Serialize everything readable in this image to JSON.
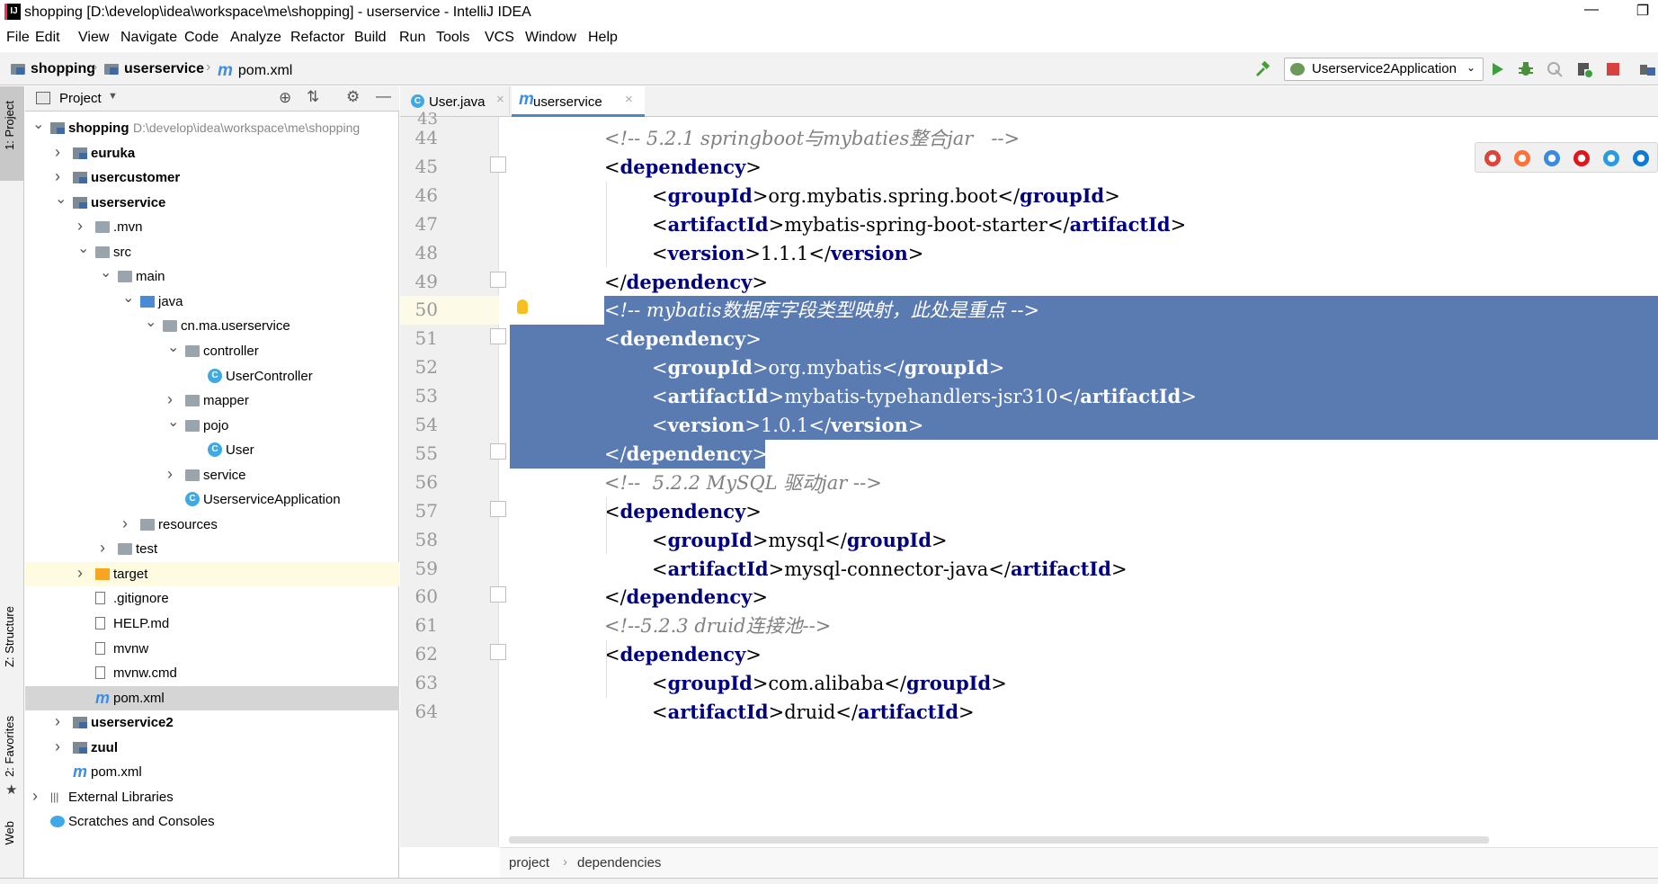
{
  "window": {
    "title": "shopping [D:\\develop\\idea\\workspace\\me\\shopping] - userservice - IntelliJ IDEA",
    "minimize": "—",
    "restore": "❐"
  },
  "menu": [
    "File",
    "Edit",
    "View",
    "Navigate",
    "Code",
    "Analyze",
    "Refactor",
    "Build",
    "Run",
    "Tools",
    "VCS",
    "Window",
    "Help"
  ],
  "nav": {
    "crumbs": [
      "shopping",
      "userservice",
      "pom.xml"
    ]
  },
  "toolbar": {
    "run_config": "Userservice2Application"
  },
  "left_tabs": [
    "1: Project",
    "Z: Structure",
    "2: Favorites",
    "Web"
  ],
  "project_panel": {
    "title": "Project",
    "tree": [
      {
        "label": "shopping",
        "extra": "D:\\develop\\idea\\workspace\\me\\shopping",
        "indent": 0,
        "arrow": "v",
        "icon": "module",
        "bold": true
      },
      {
        "label": "euruka",
        "indent": 1,
        "arrow": ">",
        "icon": "module",
        "bold": true
      },
      {
        "label": "usercustomer",
        "indent": 1,
        "arrow": ">",
        "icon": "module",
        "bold": true
      },
      {
        "label": "userservice",
        "indent": 1,
        "arrow": "v",
        "icon": "module",
        "bold": true
      },
      {
        "label": ".mvn",
        "indent": 2,
        "arrow": ">",
        "icon": "folder"
      },
      {
        "label": "src",
        "indent": 2,
        "arrow": "v",
        "icon": "folder"
      },
      {
        "label": "main",
        "indent": 3,
        "arrow": "v",
        "icon": "folder"
      },
      {
        "label": "java",
        "indent": 4,
        "arrow": "v",
        "icon": "src"
      },
      {
        "label": "cn.ma.userservice",
        "indent": 5,
        "arrow": "v",
        "icon": "folder"
      },
      {
        "label": "controller",
        "indent": 6,
        "arrow": "v",
        "icon": "folder"
      },
      {
        "label": "UserController",
        "indent": 7,
        "arrow": "",
        "icon": "class"
      },
      {
        "label": "mapper",
        "indent": 6,
        "arrow": ">",
        "icon": "folder"
      },
      {
        "label": "pojo",
        "indent": 6,
        "arrow": "v",
        "icon": "folder"
      },
      {
        "label": "User",
        "indent": 7,
        "arrow": "",
        "icon": "class"
      },
      {
        "label": "service",
        "indent": 6,
        "arrow": ">",
        "icon": "folder"
      },
      {
        "label": "UserserviceApplication",
        "indent": 6,
        "arrow": "",
        "icon": "class"
      },
      {
        "label": "resources",
        "indent": 4,
        "arrow": ">",
        "icon": "res"
      },
      {
        "label": "test",
        "indent": 3,
        "arrow": ">",
        "icon": "folder"
      },
      {
        "label": "target",
        "indent": 2,
        "arrow": ">",
        "icon": "orange",
        "highlight": "yellow"
      },
      {
        "label": ".gitignore",
        "indent": 2,
        "arrow": "",
        "icon": "file"
      },
      {
        "label": "HELP.md",
        "indent": 2,
        "arrow": "",
        "icon": "file"
      },
      {
        "label": "mvnw",
        "indent": 2,
        "arrow": "",
        "icon": "file"
      },
      {
        "label": "mvnw.cmd",
        "indent": 2,
        "arrow": "",
        "icon": "file"
      },
      {
        "label": "pom.xml",
        "indent": 2,
        "arrow": "",
        "icon": "maven",
        "highlight": "gray"
      },
      {
        "label": "userservice2",
        "indent": 1,
        "arrow": ">",
        "icon": "module",
        "bold": true
      },
      {
        "label": "zuul",
        "indent": 1,
        "arrow": ">",
        "icon": "module",
        "bold": true
      },
      {
        "label": "pom.xml",
        "indent": 1,
        "arrow": "",
        "icon": "maven"
      },
      {
        "label": "External Libraries",
        "indent": 0,
        "arrow": ">",
        "icon": "lib"
      },
      {
        "label": "Scratches and Consoles",
        "indent": 0,
        "arrow": "",
        "icon": "scratch"
      }
    ]
  },
  "editor": {
    "tabs": [
      {
        "label": "User.java",
        "icon": "C"
      },
      {
        "label": "userservice",
        "icon": "m",
        "active": true
      }
    ],
    "first_line_partial": "43",
    "lines": [
      {
        "n": "44",
        "indent": 1,
        "parts": [
          [
            "c",
            "<!-- 5.2.1 springboot与mybaties整合jar   -->"
          ]
        ]
      },
      {
        "n": "45",
        "indent": 1,
        "parts": [
          [
            "b",
            "<"
          ],
          [
            "t",
            "dependency"
          ],
          [
            "b",
            ">"
          ]
        ]
      },
      {
        "n": "46",
        "indent": 2,
        "parts": [
          [
            "b",
            "<"
          ],
          [
            "t",
            "groupId"
          ],
          [
            "b",
            ">org.mybatis.spring.boot</"
          ],
          [
            "t",
            "groupId"
          ],
          [
            "b",
            ">"
          ]
        ]
      },
      {
        "n": "47",
        "indent": 2,
        "parts": [
          [
            "b",
            "<"
          ],
          [
            "t",
            "artifactId"
          ],
          [
            "b",
            ">mybatis-spring-boot-starter</"
          ],
          [
            "t",
            "artifactId"
          ],
          [
            "b",
            ">"
          ]
        ]
      },
      {
        "n": "48",
        "indent": 2,
        "parts": [
          [
            "b",
            "<"
          ],
          [
            "t",
            "version"
          ],
          [
            "b",
            ">1.1.1</"
          ],
          [
            "t",
            "version"
          ],
          [
            "b",
            ">"
          ]
        ]
      },
      {
        "n": "49",
        "indent": 1,
        "parts": [
          [
            "b",
            "</"
          ],
          [
            "t",
            "dependency"
          ],
          [
            "b",
            ">"
          ]
        ]
      },
      {
        "n": "50",
        "indent": 1,
        "sel": true,
        "parts": [
          [
            "c",
            "<!-- mybatis数据库字段类型映射，此处是重点 -->"
          ]
        ]
      },
      {
        "n": "51",
        "indent": 1,
        "sel": true,
        "parts": [
          [
            "b",
            "<"
          ],
          [
            "t",
            "dependency"
          ],
          [
            "b",
            ">"
          ]
        ]
      },
      {
        "n": "52",
        "indent": 2,
        "sel": true,
        "parts": [
          [
            "b",
            "<"
          ],
          [
            "t",
            "groupId"
          ],
          [
            "b",
            ">org.mybatis</"
          ],
          [
            "t",
            "groupId"
          ],
          [
            "b",
            ">"
          ]
        ]
      },
      {
        "n": "53",
        "indent": 2,
        "sel": true,
        "parts": [
          [
            "b",
            "<"
          ],
          [
            "t",
            "artifactId"
          ],
          [
            "b",
            ">mybatis-typehandlers-jsr310</"
          ],
          [
            "t",
            "artifactId"
          ],
          [
            "b",
            ">"
          ]
        ]
      },
      {
        "n": "54",
        "indent": 2,
        "sel": true,
        "parts": [
          [
            "b",
            "<"
          ],
          [
            "t",
            "version"
          ],
          [
            "b",
            ">1.0.1</"
          ],
          [
            "t",
            "version"
          ],
          [
            "b",
            ">"
          ]
        ]
      },
      {
        "n": "55",
        "indent": 1,
        "sel": true,
        "parts": [
          [
            "b",
            "</"
          ],
          [
            "t",
            "dependency"
          ],
          [
            "b",
            ">"
          ]
        ]
      },
      {
        "n": "56",
        "indent": 1,
        "parts": [
          [
            "c",
            "<!--  5.2.2 MySQL 驱动jar -->"
          ]
        ]
      },
      {
        "n": "57",
        "indent": 1,
        "parts": [
          [
            "b",
            "<"
          ],
          [
            "t",
            "dependency"
          ],
          [
            "b",
            ">"
          ]
        ]
      },
      {
        "n": "58",
        "indent": 2,
        "parts": [
          [
            "b",
            "<"
          ],
          [
            "t",
            "groupId"
          ],
          [
            "b",
            ">mysql</"
          ],
          [
            "t",
            "groupId"
          ],
          [
            "b",
            ">"
          ]
        ]
      },
      {
        "n": "59",
        "indent": 2,
        "parts": [
          [
            "b",
            "<"
          ],
          [
            "t",
            "artifactId"
          ],
          [
            "b",
            ">mysql-connector-java</"
          ],
          [
            "t",
            "artifactId"
          ],
          [
            "b",
            ">"
          ]
        ]
      },
      {
        "n": "60",
        "indent": 1,
        "parts": [
          [
            "b",
            "</"
          ],
          [
            "t",
            "dependency"
          ],
          [
            "b",
            ">"
          ]
        ]
      },
      {
        "n": "61",
        "indent": 1,
        "parts": [
          [
            "c",
            "<!--5.2.3 druid连接池-->"
          ]
        ]
      },
      {
        "n": "62",
        "indent": 1,
        "parts": [
          [
            "b",
            "<"
          ],
          [
            "t",
            "dependency"
          ],
          [
            "b",
            ">"
          ]
        ]
      },
      {
        "n": "63",
        "indent": 2,
        "parts": [
          [
            "b",
            "<"
          ],
          [
            "t",
            "groupId"
          ],
          [
            "b",
            ">com.alibaba</"
          ],
          [
            "t",
            "groupId"
          ],
          [
            "b",
            ">"
          ]
        ]
      },
      {
        "n": "64",
        "indent": 2,
        "parts": [
          [
            "b",
            "<"
          ],
          [
            "t",
            "artifactId"
          ],
          [
            "b",
            ">druid</"
          ],
          [
            "t",
            "artifactId"
          ],
          [
            "b",
            ">"
          ]
        ]
      }
    ]
  },
  "breadcrumb": [
    "project",
    "dependencies"
  ],
  "browsers": [
    {
      "name": "chrome-icon",
      "color": "#db4437"
    },
    {
      "name": "firefox-icon",
      "color": "#ff7139"
    },
    {
      "name": "safari-icon",
      "color": "#3a8be0"
    },
    {
      "name": "opera-icon",
      "color": "#e0161e"
    },
    {
      "name": "ie-icon",
      "color": "#2a9be0"
    },
    {
      "name": "edge-icon",
      "color": "#0a7bd6"
    }
  ]
}
